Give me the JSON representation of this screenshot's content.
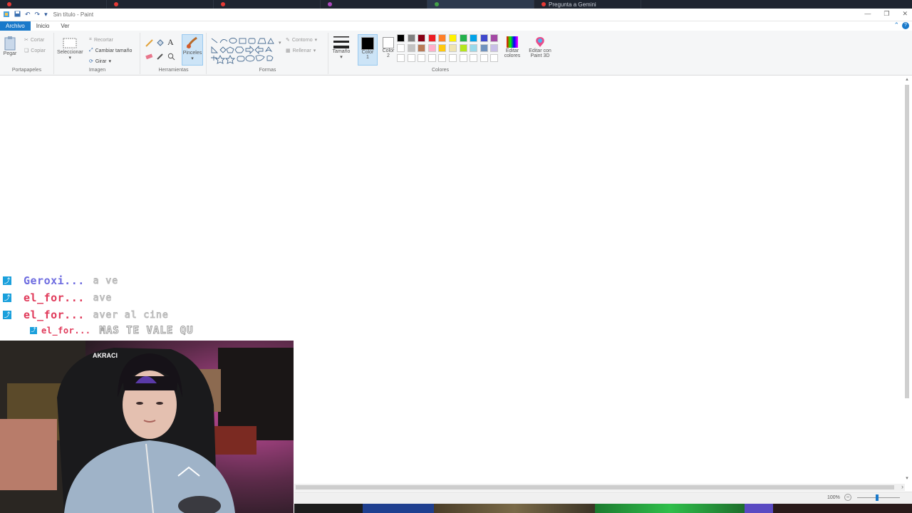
{
  "browser": {
    "tabs": [
      {
        "label": "",
        "color": "#e53935"
      },
      {
        "label": "",
        "color": "#e53935"
      },
      {
        "label": "",
        "color": "#e53935"
      },
      {
        "label": "",
        "color": "#ab47bc"
      },
      {
        "label": "",
        "color": "#43a047",
        "active": true
      },
      {
        "label": "Pregunta a Gemini",
        "color": "#e53935"
      }
    ]
  },
  "window": {
    "title": "Sin título - Paint"
  },
  "ribbon_tabs": [
    "Archivo",
    "Inicio",
    "Ver"
  ],
  "ribbon": {
    "clipboard": {
      "paste": "Pegar",
      "cut": "Cortar",
      "copy": "Copiar",
      "label": "Portapapeles"
    },
    "image": {
      "select": "Seleccionar",
      "crop": "Recortar",
      "resize": "Cambiar tamaño",
      "rotate": "Girar",
      "label": "Imagen"
    },
    "tools": {
      "brushes": "Pinceles",
      "label": "Herramientas"
    },
    "shapes": {
      "outline": "Contorno",
      "fill": "Rellenar",
      "label": "Formas"
    },
    "size": {
      "label": "Tamaño"
    },
    "colors": {
      "color1": "Color",
      "color1_num": "1",
      "color2": "Color",
      "color2_num": "2",
      "edit_colors": "Editar",
      "edit_colors2": "colores",
      "paint3d": "Editar con",
      "paint3d2": "Paint 3D",
      "label": "Colores",
      "palette": [
        "#000000",
        "#7f7f7f",
        "#880015",
        "#ed1c24",
        "#ff7f27",
        "#fff200",
        "#22b14c",
        "#00a2e8",
        "#3f48cc",
        "#a349a4",
        "#ffffff",
        "#c3c3c3",
        "#b97a57",
        "#ffaec9",
        "#ffc90e",
        "#efe4b0",
        "#b5e61d",
        "#99d9ea",
        "#7092be",
        "#c8bfe7",
        "#ffffff",
        "#ffffff",
        "#ffffff",
        "#ffffff",
        "#ffffff",
        "#ffffff",
        "#ffffff",
        "#ffffff",
        "#ffffff",
        "#ffffff"
      ]
    }
  },
  "chat": [
    {
      "user": "Geroxi...",
      "message": "a ve",
      "user_color": "#6e6ce0"
    },
    {
      "user": "el_for...",
      "message": "ave",
      "user_color": "#e03a5a"
    },
    {
      "user": "el_for...",
      "message": "aver al cine",
      "user_color": "#e03a5a"
    },
    {
      "user": "el_for...",
      "message": "MAS TE VALE QU",
      "user_color": "#e03a5a",
      "small": true
    }
  ],
  "status": {
    "zoom": "100%"
  },
  "colors": {
    "accent": "#1979ca",
    "chat_badge": "#1aa0dc"
  }
}
